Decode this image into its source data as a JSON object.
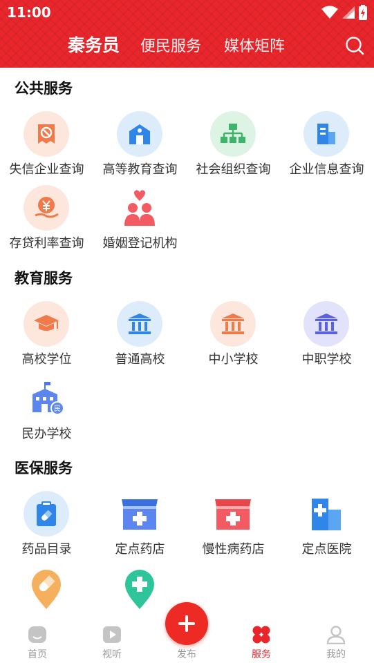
{
  "status_bar": {
    "time": "11:00"
  },
  "header": {
    "tabs": [
      {
        "label": "秦务员",
        "active": true
      },
      {
        "label": "便民服务",
        "active": false
      },
      {
        "label": "媒体矩阵",
        "active": false
      }
    ],
    "search_icon": "search-icon",
    "accent_color": "#e8262c"
  },
  "sections": [
    {
      "title": "公共服务",
      "items": [
        {
          "label": "失信企业查询",
          "icon": "seal-ban-icon"
        },
        {
          "label": "高等教育查询",
          "icon": "school-building-icon"
        },
        {
          "label": "社会组织查询",
          "icon": "org-chart-icon"
        },
        {
          "label": "企业信息查询",
          "icon": "office-building-icon"
        },
        {
          "label": "存贷利率查询",
          "icon": "yuan-coin-hand-icon"
        },
        {
          "label": "婚姻登记机构",
          "icon": "couple-heart-icon"
        }
      ]
    },
    {
      "title": "教育服务",
      "items": [
        {
          "label": "高校学位",
          "icon": "graduation-cap-icon"
        },
        {
          "label": "普通高校",
          "icon": "institution-icon"
        },
        {
          "label": "中小学校",
          "icon": "institution-icon"
        },
        {
          "label": "中职学校",
          "icon": "institution-icon"
        },
        {
          "label": "民办学校",
          "icon": "private-school-icon"
        }
      ]
    },
    {
      "title": "医保服务",
      "items": [
        {
          "label": "药品目录",
          "icon": "pill-clipboard-icon"
        },
        {
          "label": "定点药店",
          "icon": "pharmacy-store-icon"
        },
        {
          "label": "慢性病药店",
          "icon": "pharmacy-store-icon"
        },
        {
          "label": "定点医院",
          "icon": "hospital-icon"
        },
        {
          "label": "",
          "icon": "pill-location-icon"
        },
        {
          "label": "",
          "icon": "cross-location-icon"
        }
      ]
    }
  ],
  "bottom_nav": {
    "items": [
      {
        "label": "首页",
        "icon": "home-icon",
        "active": false
      },
      {
        "label": "视听",
        "icon": "play-icon",
        "active": false
      },
      {
        "label": "服务",
        "icon": "clover-grid-icon",
        "active": true
      },
      {
        "label": "我的",
        "icon": "user-icon",
        "active": false
      }
    ],
    "publish": {
      "label": "发布",
      "icon": "plus-icon"
    }
  }
}
